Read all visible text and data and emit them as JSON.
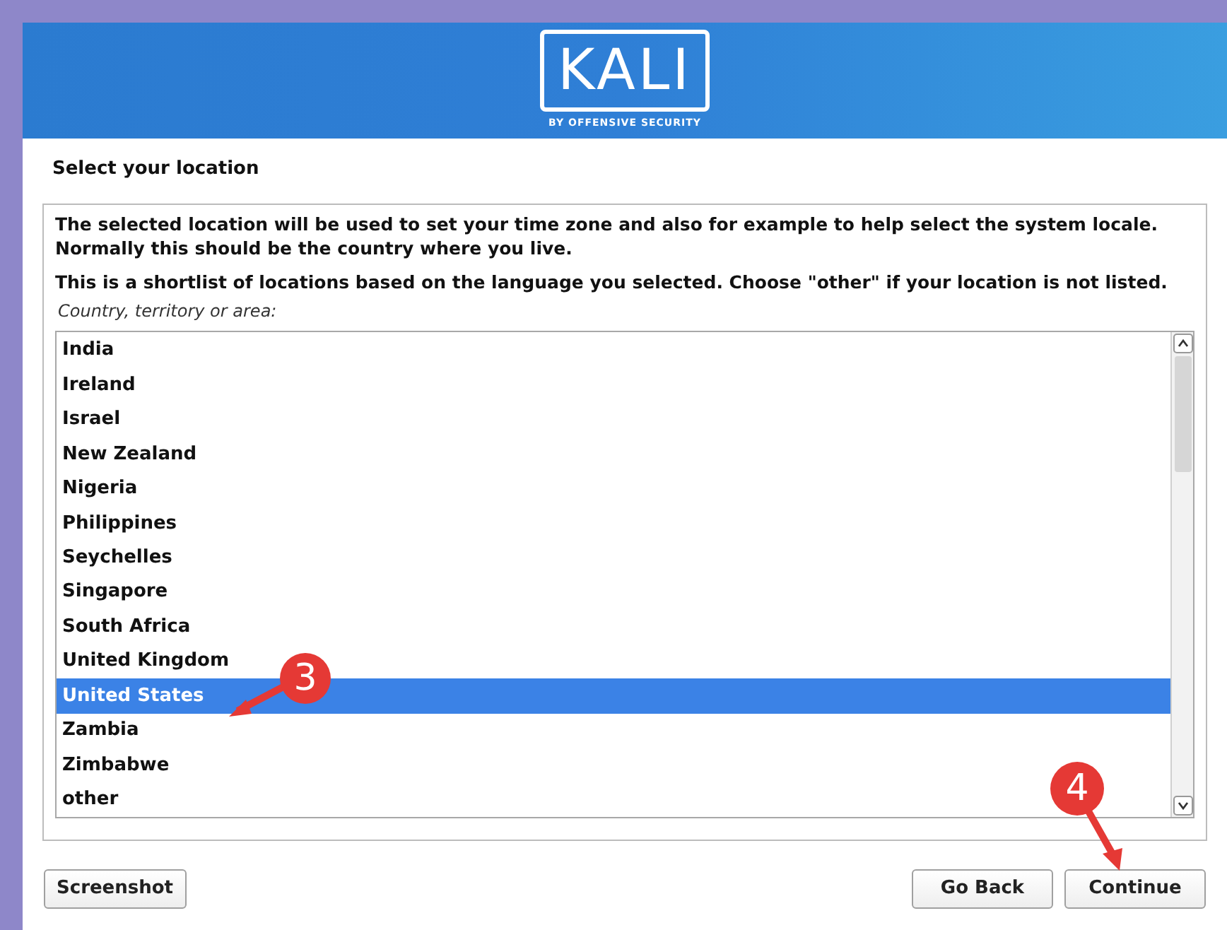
{
  "header": {
    "logo": "KALI",
    "tagline": "BY OFFENSIVE SECURITY"
  },
  "title": "Select your location",
  "description": [
    "The selected location will be used to set your time zone and also for example to help select the system locale. Normally this should be the country where you live.",
    "This is a shortlist of locations based on the language you selected. Choose \"other\" if your location is not listed."
  ],
  "list_label": "Country, territory or area:",
  "locations": [
    {
      "label": "India",
      "selected": false
    },
    {
      "label": "Ireland",
      "selected": false
    },
    {
      "label": "Israel",
      "selected": false
    },
    {
      "label": "New Zealand",
      "selected": false
    },
    {
      "label": "Nigeria",
      "selected": false
    },
    {
      "label": "Philippines",
      "selected": false
    },
    {
      "label": "Seychelles",
      "selected": false
    },
    {
      "label": "Singapore",
      "selected": false
    },
    {
      "label": "South Africa",
      "selected": false
    },
    {
      "label": "United Kingdom",
      "selected": false
    },
    {
      "label": "United States",
      "selected": true
    },
    {
      "label": "Zambia",
      "selected": false
    },
    {
      "label": "Zimbabwe",
      "selected": false
    },
    {
      "label": "other",
      "selected": false
    }
  ],
  "buttons": {
    "left": [
      "Screenshot"
    ],
    "right": [
      "Go Back",
      "Continue"
    ]
  },
  "annotations": [
    {
      "label": "3",
      "kind": "left"
    },
    {
      "label": "4",
      "kind": "down"
    }
  ]
}
